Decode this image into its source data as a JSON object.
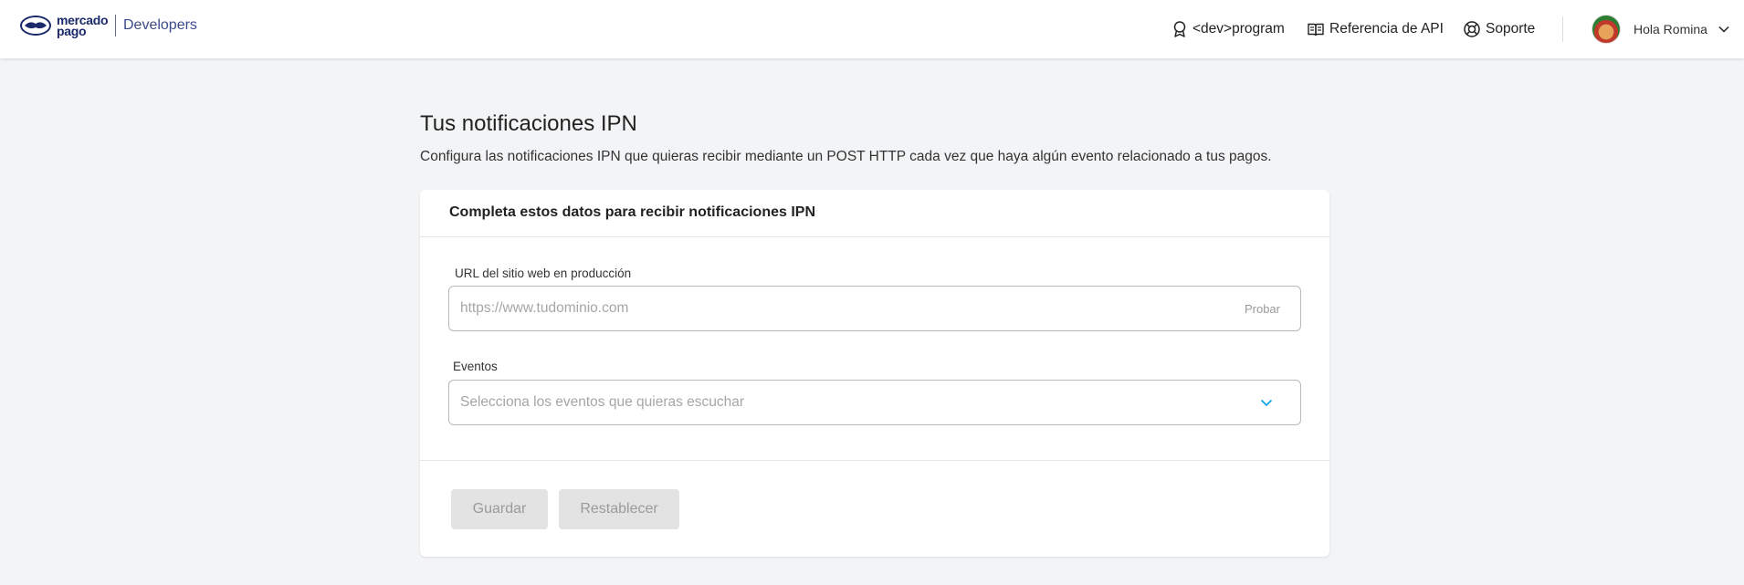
{
  "header": {
    "logo_text_line1": "mercado",
    "logo_text_line2": "pago",
    "logo_product": "Developers",
    "nav": {
      "program": "<dev>program",
      "api_reference": "Referencia de API",
      "support": "Soporte"
    },
    "user": {
      "greeting": "Hola Romina"
    }
  },
  "page": {
    "title": "Tus notificaciones IPN",
    "subtitle": "Configura las notificaciones IPN que quieras recibir mediante un POST HTTP cada vez que haya algún evento relacionado a tus pagos."
  },
  "form": {
    "card_title": "Completa estos datos para recibir notificaciones IPN",
    "url_label": "URL del sitio web en producción",
    "url_placeholder": "https://www.tudominio.com",
    "url_value": "",
    "test_button": "Probar",
    "events_label": "Eventos",
    "events_placeholder": "Selecciona los eventos que quieras escuchar",
    "save_button": "Guardar",
    "reset_button": "Restablecer"
  },
  "colors": {
    "brand_navy": "#1b2a6b",
    "accent_blue": "#009ee3",
    "page_bg": "#f3f4f6",
    "disabled_button_bg": "#e3e3e3"
  }
}
